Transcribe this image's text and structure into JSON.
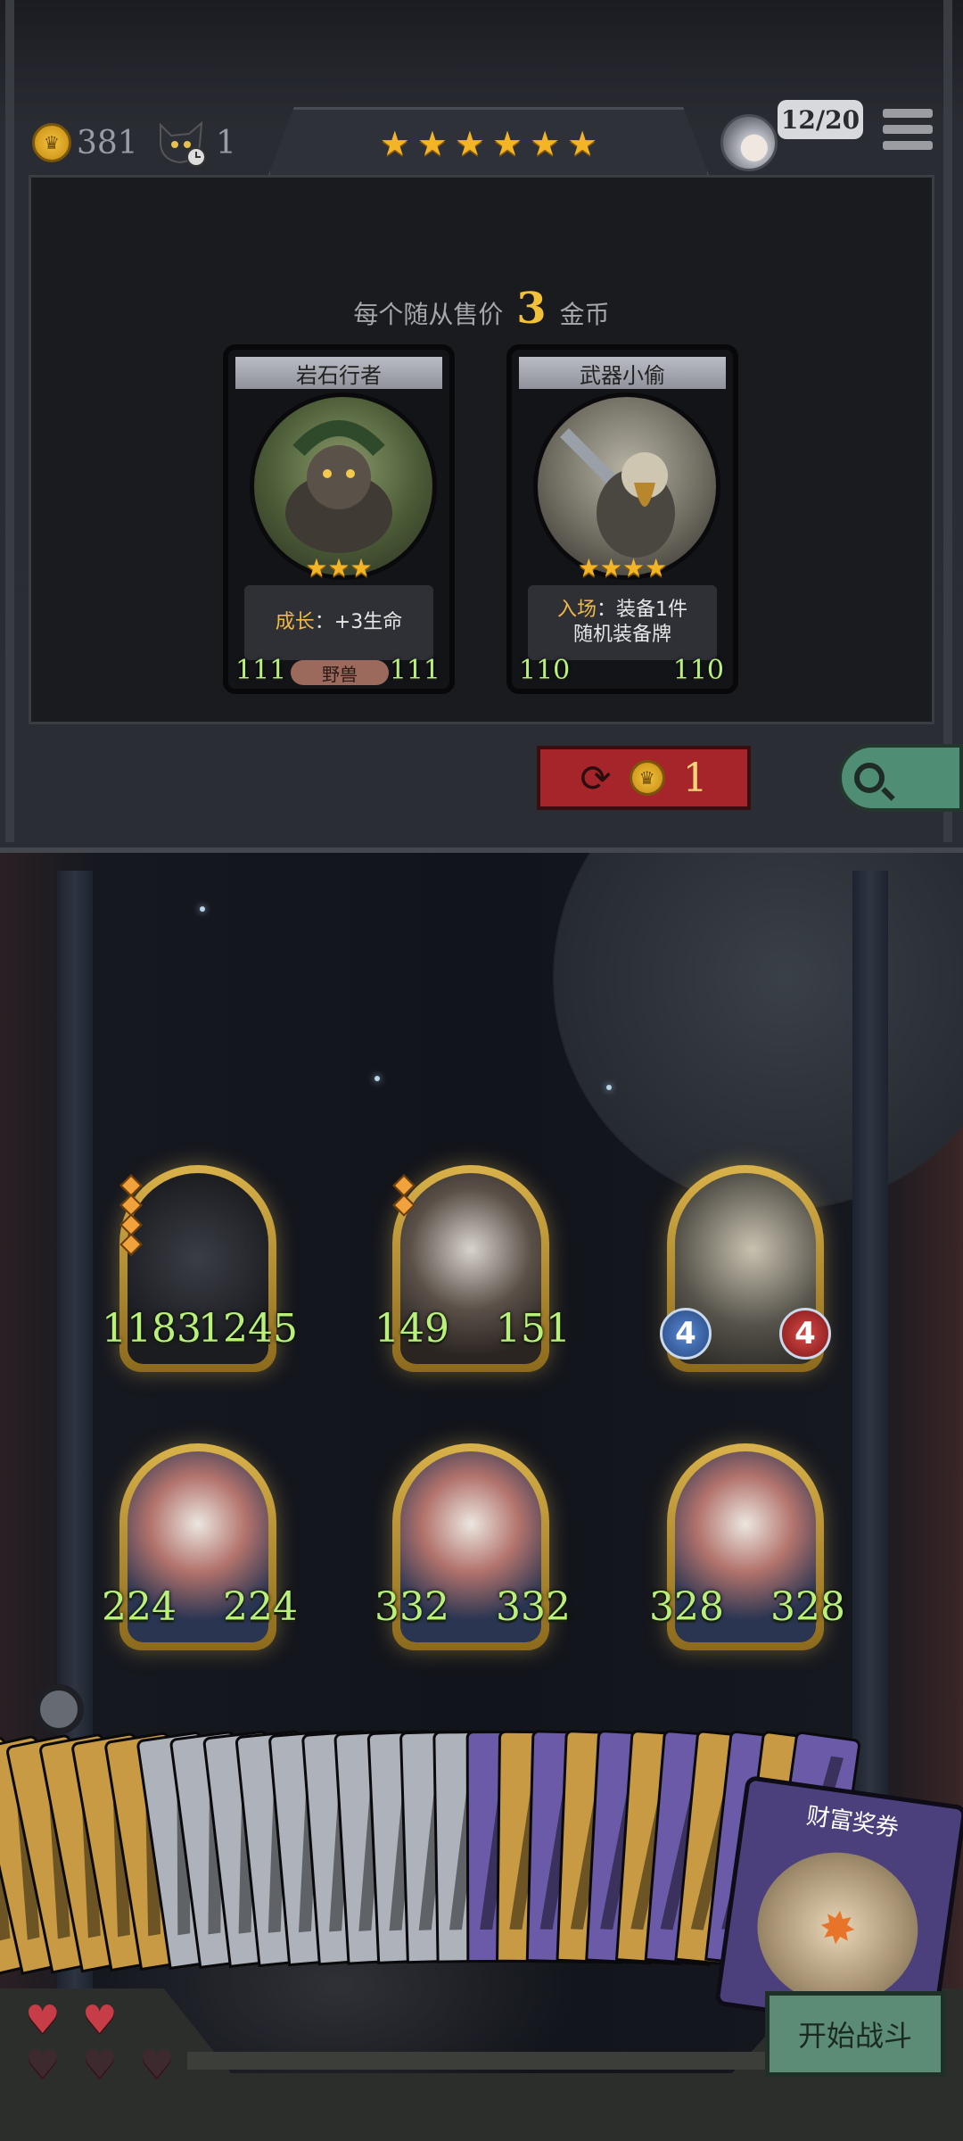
{
  "hud": {
    "gold": "381",
    "gold_icon": "gold-coin-icon",
    "turn": "1",
    "turn_icon": "crow-clock-icon",
    "tier_stars": 6,
    "board_count": "12/20",
    "avatar_icon": "player-avatar",
    "menu_icon": "hamburger-menu-icon"
  },
  "shop": {
    "price_prefix": "每个随从售价",
    "price_value": "3",
    "price_suffix": "金币",
    "cards": [
      {
        "name": "岩石行者",
        "stars": 3,
        "desc_keyword": "成长",
        "desc_rest": "：+3生命",
        "desc_line2": "",
        "attack": "111",
        "health": "111",
        "tribe": "野兽",
        "art": "rock-walker-portrait"
      },
      {
        "name": "武器小偷",
        "stars": 4,
        "desc_keyword": "入场",
        "desc_rest": "：装备1件",
        "desc_line2": "随机装备牌",
        "attack": "110",
        "health": "110",
        "tribe": "",
        "art": "weapon-thief-portrait"
      }
    ],
    "refresh_cost": "1",
    "refresh_icon": "refresh-icon",
    "search_icon": "magnifier-icon"
  },
  "board": {
    "minions": [
      {
        "art": "black-panther",
        "attack": "1183",
        "health": "1245",
        "style": "numbers",
        "gems": 4
      },
      {
        "art": "masked-rabbit",
        "attack": "149",
        "health": "151",
        "style": "numbers",
        "gems": 2
      },
      {
        "art": "weapon-thief",
        "attack": "4",
        "health": "4",
        "style": "orbs",
        "gems": 0
      },
      {
        "art": "pumpkin-rabbit",
        "attack": "224",
        "health": "224",
        "style": "numbers",
        "gems": 0
      },
      {
        "art": "pumpkin-rabbit",
        "attack": "332",
        "health": "332",
        "style": "numbers",
        "gems": 0
      },
      {
        "art": "pumpkin-rabbit",
        "attack": "328",
        "health": "328",
        "style": "numbers",
        "gems": 0
      }
    ],
    "inspect_icon": "magnifier-icon"
  },
  "deck": {
    "card_colors": [
      "#2f6b4f",
      "#c79a43",
      "#c79a43",
      "#c79a43",
      "#c79a43",
      "#c79a43",
      "#c79a43",
      "#aeb2ba",
      "#aeb2ba",
      "#aeb2ba",
      "#aeb2ba",
      "#aeb2ba",
      "#aeb2ba",
      "#aeb2ba",
      "#aeb2ba",
      "#aeb2ba",
      "#aeb2ba",
      "#6b5aa8",
      "#c79a43",
      "#6b5aa8",
      "#c79a43",
      "#6b5aa8",
      "#c79a43",
      "#6b5aa8",
      "#c79a43",
      "#6b5aa8",
      "#c79a43",
      "#6b5aa8"
    ],
    "reward_title": "财富奖券",
    "reward_icon": "treasure-ticket-icon"
  },
  "lives": {
    "full": 2,
    "total": 5,
    "heart_color": "#c63d47"
  },
  "start_button": "开始战斗"
}
